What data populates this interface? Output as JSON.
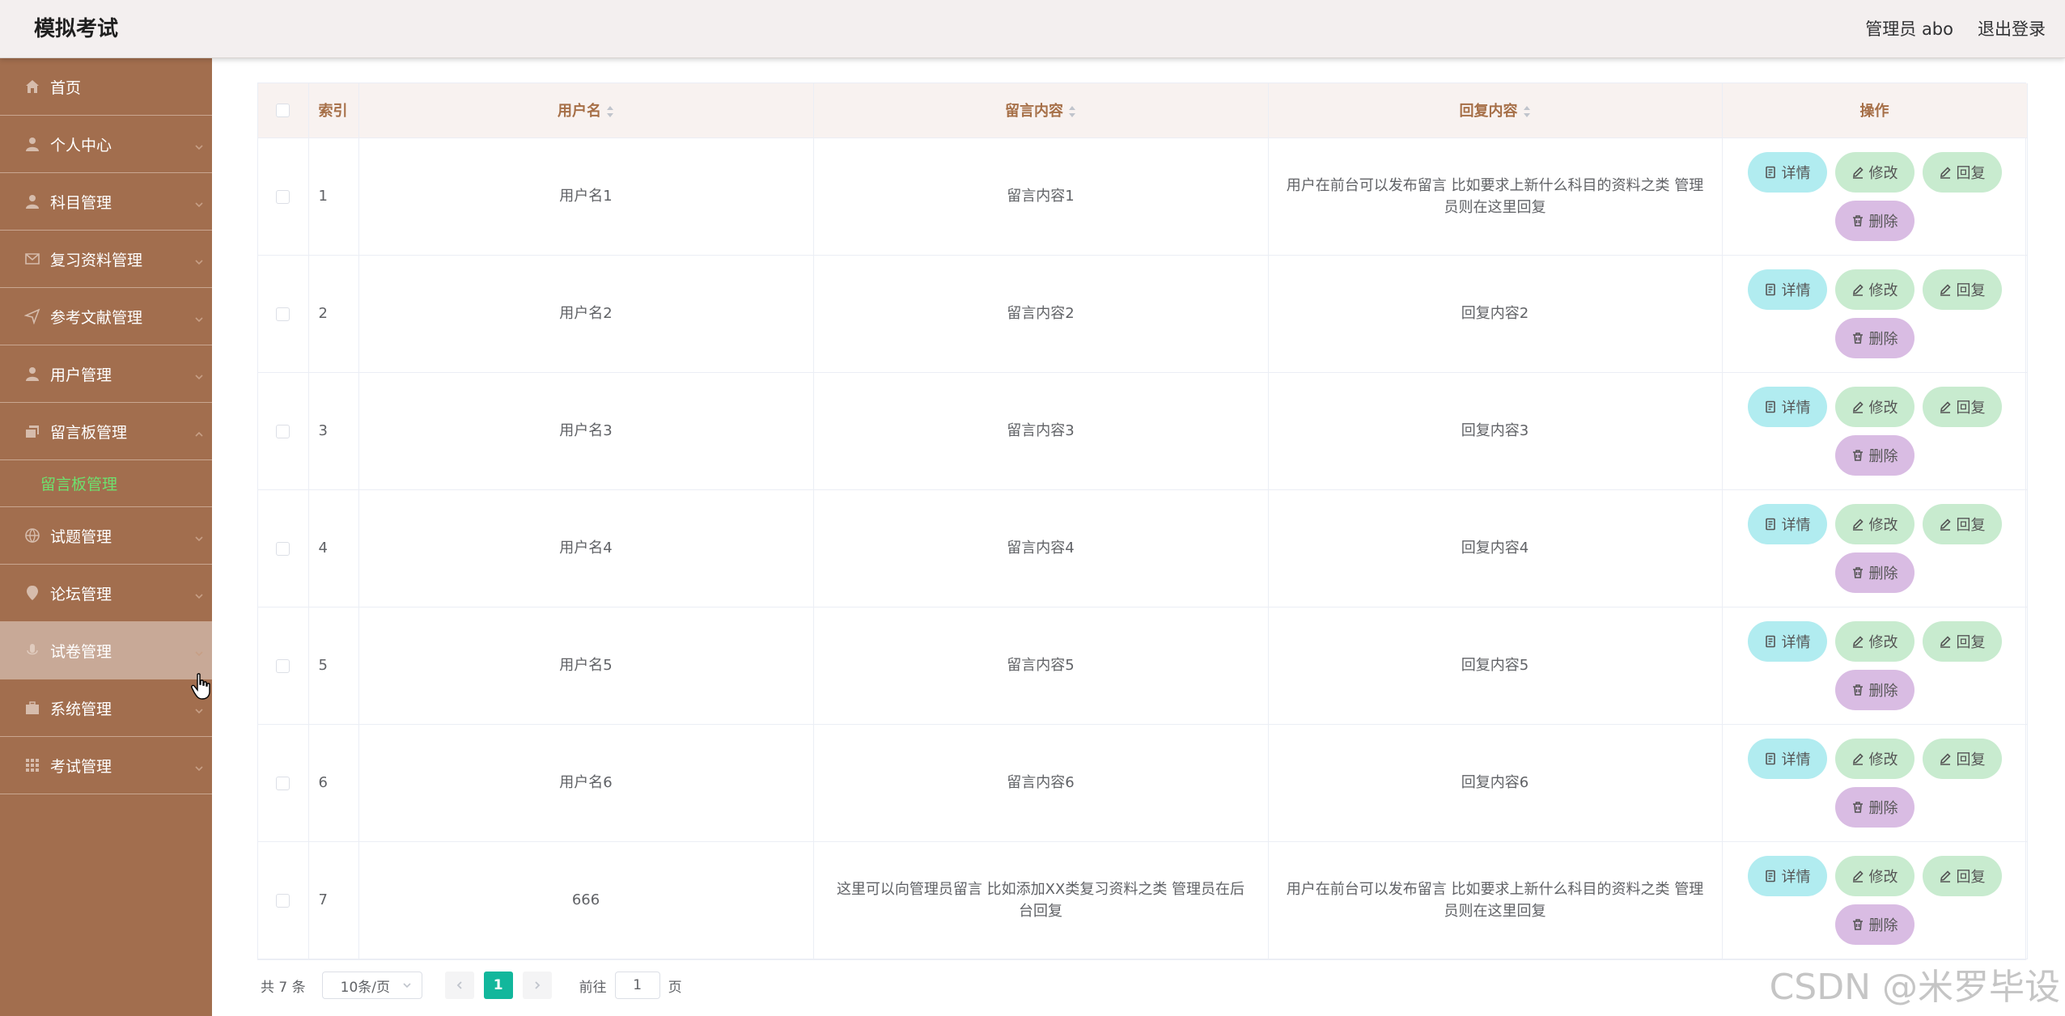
{
  "app_title": "模拟考试",
  "header": {
    "admin_label": "管理员 abo",
    "logout_label": "退出登录"
  },
  "sidebar": {
    "items": [
      {
        "label": "首页",
        "icon": "home-icon"
      },
      {
        "label": "个人中心",
        "icon": "user-icon"
      },
      {
        "label": "科目管理",
        "icon": "user-icon"
      },
      {
        "label": "复习资料管理",
        "icon": "mail-icon"
      },
      {
        "label": "参考文献管理",
        "icon": "send-icon"
      },
      {
        "label": "用户管理",
        "icon": "user-icon"
      },
      {
        "label": "留言板管理",
        "icon": "message-icon"
      },
      {
        "label": "试题管理",
        "icon": "globe-icon"
      },
      {
        "label": "论坛管理",
        "icon": "location-icon"
      },
      {
        "label": "试卷管理",
        "icon": "mic-icon"
      },
      {
        "label": "系统管理",
        "icon": "briefcase-icon"
      },
      {
        "label": "考试管理",
        "icon": "grid-icon"
      }
    ],
    "submenu_label": "留言板管理"
  },
  "table": {
    "headers": {
      "index": "索引",
      "username": "用户名",
      "content": "留言内容",
      "reply": "回复内容",
      "actions": "操作"
    },
    "buttons": {
      "detail": "详情",
      "edit": "修改",
      "reply": "回复",
      "delete": "删除"
    },
    "rows": [
      {
        "index": "1",
        "username": "用户名1",
        "content": "留言内容1",
        "reply": "用户在前台可以发布留言 比如要求上新什么科目的资料之类 管理员则在这里回复"
      },
      {
        "index": "2",
        "username": "用户名2",
        "content": "留言内容2",
        "reply": "回复内容2"
      },
      {
        "index": "3",
        "username": "用户名3",
        "content": "留言内容3",
        "reply": "回复内容3"
      },
      {
        "index": "4",
        "username": "用户名4",
        "content": "留言内容4",
        "reply": "回复内容4"
      },
      {
        "index": "5",
        "username": "用户名5",
        "content": "留言内容5",
        "reply": "回复内容5"
      },
      {
        "index": "6",
        "username": "用户名6",
        "content": "留言内容6",
        "reply": "回复内容6"
      },
      {
        "index": "7",
        "username": "666",
        "content": "这里可以向管理员留言 比如添加XX类复习资料之类 管理员在后台回复",
        "reply": "用户在前台可以发布留言 比如要求上新什么科目的资料之类 管理员则在这里回复"
      }
    ]
  },
  "pager": {
    "total": "共 7 条",
    "page_size": "10条/页",
    "current_page": "1",
    "goto_prefix": "前往",
    "goto_value": "1",
    "goto_suffix": "页"
  },
  "watermark": "CSDN @米罗毕设"
}
